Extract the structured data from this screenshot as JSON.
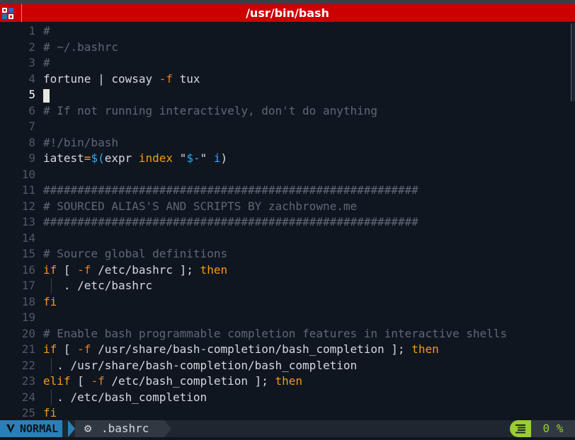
{
  "window": {
    "title": "/usr/bin/bash"
  },
  "editor": {
    "lines": [
      {
        "n": "1",
        "t": "#"
      },
      {
        "n": "2",
        "t": "# ~/.bashrc"
      },
      {
        "n": "3",
        "t": "#"
      },
      {
        "n": "4",
        "t": "fortune | cowsay -f tux"
      },
      {
        "n": "5",
        "t": ""
      },
      {
        "n": "6",
        "t": "# If not running interactively, don't do anything"
      },
      {
        "n": "7",
        "t": ""
      },
      {
        "n": "8",
        "t": "#!/bin/bash"
      },
      {
        "n": "9",
        "t": "iatest=$(expr index \"$-\" i)"
      },
      {
        "n": "10",
        "t": ""
      },
      {
        "n": "11",
        "t": "#######################################################"
      },
      {
        "n": "12",
        "t": "# SOURCED ALIAS'S AND SCRIPTS BY zachbrowne.me"
      },
      {
        "n": "13",
        "t": "#######################################################"
      },
      {
        "n": "14",
        "t": ""
      },
      {
        "n": "15",
        "t": "# Source global definitions"
      },
      {
        "n": "16",
        "t": "if [ -f /etc/bashrc ]; then"
      },
      {
        "n": "17",
        "t": "   . /etc/bashrc"
      },
      {
        "n": "18",
        "t": "fi"
      },
      {
        "n": "19",
        "t": ""
      },
      {
        "n": "20",
        "t": "# Enable bash programmable completion features in interactive shells"
      },
      {
        "n": "21",
        "t": "if [ -f /usr/share/bash-completion/bash_completion ]; then"
      },
      {
        "n": "22",
        "t": "  . /usr/share/bash-completion/bash_completion"
      },
      {
        "n": "23",
        "t": "elif [ -f /etc/bash_completion ]; then"
      },
      {
        "n": "24",
        "t": "  . /etc/bash_completion"
      },
      {
        "n": "25",
        "t": "fi"
      }
    ],
    "current_line": "5"
  },
  "statusbar": {
    "mode": "NORMAL",
    "mode_icon": "vim-icon",
    "file_icon": "gear-icon",
    "filename": ".bashrc",
    "position_icon": "lines-icon",
    "percent": "0 %"
  },
  "colors": {
    "titlebar": "#cc0000",
    "background": "#0f1620",
    "mode_accent": "#2980b9",
    "keyword": "#f39c12",
    "comment": "#5e6875",
    "percent_accent": "#9acd32"
  }
}
